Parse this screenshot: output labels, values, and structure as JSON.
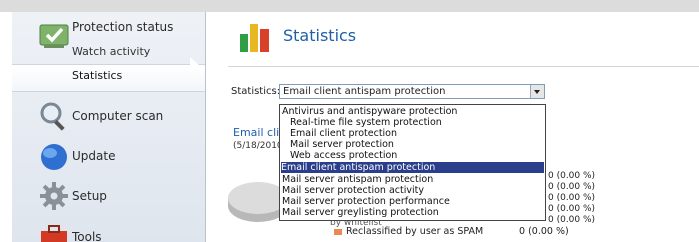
{
  "sidebar": {
    "protection_status": "Protection status",
    "watch_activity": "Watch activity",
    "statistics": "Statistics",
    "computer_scan": "Computer scan",
    "update": "Update",
    "setup": "Setup",
    "tools": "Tools"
  },
  "main": {
    "title": "Statistics",
    "statistics_label": "Statistics:",
    "selected_value": "Email client antispam protection",
    "options": [
      "Antivirus and antispyware protection",
      "Real-time file system protection",
      "Email client protection",
      "Mail server protection",
      "Web access protection",
      "Email client antispam protection",
      "Mail server antispam protection",
      "Mail server protection activity",
      "Mail server protection performance",
      "Mail server greylisting protection"
    ],
    "section_title": "Email clie",
    "section_date": "(5/18/2010",
    "right_values": [
      "0 (0.00 %)",
      "0 (0.00 %)",
      "0 (0.00 %)",
      "0 (0.00 %)",
      "0 (0.00 %)"
    ],
    "bottom_row_label": "Reclassified by user as SPAM",
    "bottom_row_value": "0 (0.00 %)",
    "partial_label": "by whitelist"
  },
  "colors": {
    "accent": "#1e5fa8",
    "selected_option": "#2a3e8c",
    "swatch": "#e88a55"
  }
}
